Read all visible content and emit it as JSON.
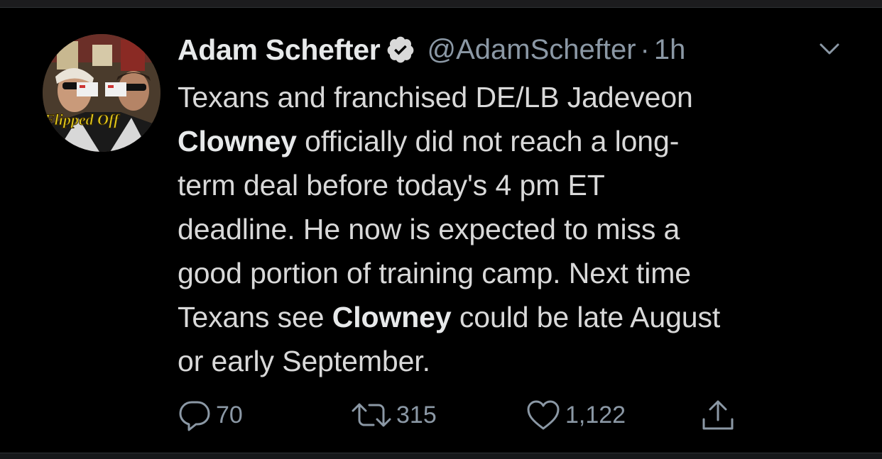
{
  "tweet": {
    "display_name": "Adam Schefter",
    "handle": "@AdamSchefter",
    "separator": "·",
    "time": "1h",
    "avatar_caption": "Flipped Off",
    "lines": [
      [
        "Texans and franchised DE/LB Jadeveon",
        null
      ],
      [
        "",
        "Clowney",
        " officially did not reach a long-"
      ],
      [
        "term deal before today's 4 pm ET",
        null
      ],
      [
        "deadline. He now is expected to miss a",
        null
      ],
      [
        "good portion of training camp. Next time",
        null
      ],
      [
        "Texans see ",
        "Clowney",
        " could be late August"
      ],
      [
        "or early September.",
        null
      ]
    ],
    "text": {
      "line1": "Texans and franchised DE/LB Jadeveon",
      "line2_bold": "Clowney",
      "line2_rest": " officially did not reach a long-",
      "line3": "term deal before today's 4 pm ET",
      "line4": "deadline. He now is expected to miss a",
      "line5": "good portion of training camp. Next time",
      "line6_pre": "Texans see ",
      "line6_bold": "Clowney",
      "line6_rest": " could be late August",
      "line7": "or early September."
    }
  },
  "actions": {
    "reply_count": "70",
    "retweet_count": "315",
    "like_count": "1,122"
  },
  "icons": {
    "verified": "verified-badge-icon",
    "chevron": "chevron-down-icon",
    "reply": "reply-icon",
    "retweet": "retweet-icon",
    "like": "heart-icon",
    "share": "share-icon"
  },
  "colors": {
    "background": "#000000",
    "text": "#d9d9d9",
    "muted": "#8b98a5",
    "name": "#e7e9ea"
  }
}
